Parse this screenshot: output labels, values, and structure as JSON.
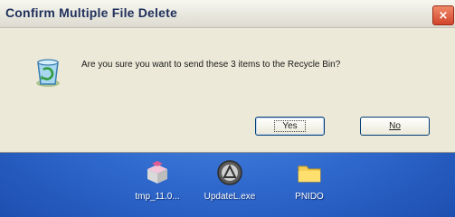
{
  "dialog": {
    "title": "Confirm Multiple File Delete",
    "close_label": "×",
    "icon": "recycle-bin-icon",
    "message": "Are you sure you want to send these 3 items to the Recycle Bin?",
    "yes_label": "Yes",
    "no_label": "No"
  },
  "desktop": {
    "icons": [
      {
        "label": "tmp_11.0...",
        "icon": "installer-box-icon"
      },
      {
        "label": "UpdateL.exe",
        "icon": "update-globe-icon"
      },
      {
        "label": "PNIDO",
        "icon": "folder-icon"
      }
    ]
  },
  "colors": {
    "dialog_bg": "#ece9d8",
    "desktop_bg": "#2f68cc",
    "title_text": "#1e2f5b",
    "close_button": "#d2442a"
  }
}
